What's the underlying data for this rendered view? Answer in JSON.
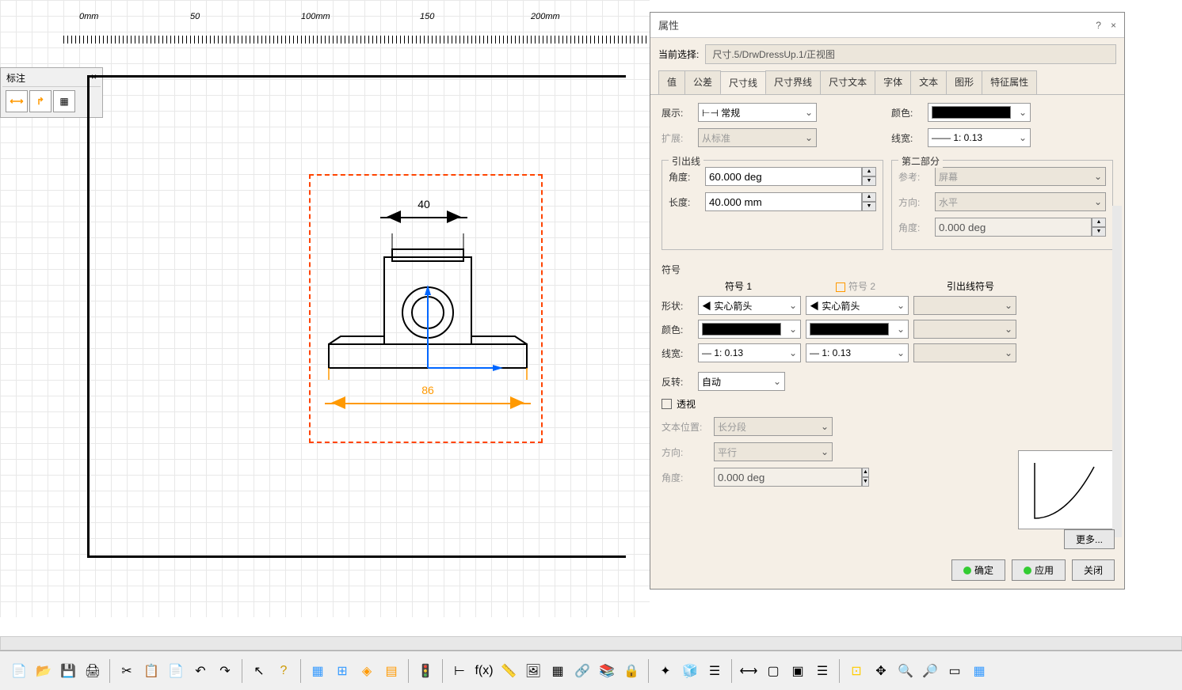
{
  "canvas": {
    "ruler_marks": [
      "0mm",
      "50",
      "100mm",
      "150",
      "200mm"
    ],
    "small_toolbar_title": "标注",
    "small_toolbar_close": "×",
    "dim_top": "40",
    "dim_bottom": "86"
  },
  "props": {
    "title": "属性",
    "help": "?",
    "close": "×",
    "current_sel_label": "当前选择:",
    "current_sel_value": "尺寸.5/DrwDressUp.1/正视图",
    "tabs": [
      "值",
      "公差",
      "尺寸线",
      "尺寸界线",
      "尺寸文本",
      "字体",
      "文本",
      "图形",
      "特征属性"
    ],
    "active_tab": "尺寸线",
    "display_label": "展示:",
    "display_value": "常规",
    "extend_label": "扩展:",
    "extend_value": "从标准",
    "color_label": "颜色:",
    "linewidth_label": "线宽:",
    "linewidth_value": "1: 0.13",
    "leader": {
      "title": "引出线",
      "angle_label": "角度:",
      "angle_value": "60.000 deg",
      "length_label": "长度:",
      "length_value": "40.000 mm"
    },
    "part2": {
      "title": "第二部分",
      "ref_label": "参考:",
      "ref_value": "屏幕",
      "dir_label": "方向:",
      "dir_value": "水平",
      "angle_label": "角度:",
      "angle_value": "0.000 deg"
    },
    "symbols": {
      "title": "符号",
      "sym1_header": "符号 1",
      "sym2_header": "符号 2",
      "leader_sym_header": "引出线符号",
      "shape_label": "形状:",
      "shape_value": "实心箭头",
      "color_label": "颜色:",
      "lw_label": "线宽:",
      "lw_value": "1: 0.13"
    },
    "reverse_label": "反转:",
    "reverse_value": "自动",
    "perspective_label": "透视",
    "text_pos_label": "文本位置:",
    "text_pos_value": "长分段",
    "dir_label": "方向:",
    "dir_value": "平行",
    "ang_label": "角度:",
    "ang_value": "0.000 deg",
    "more_btn": "更多...",
    "ok_btn": "确定",
    "apply_btn": "应用",
    "close_btn": "关闭"
  },
  "icons": {
    "display_icon": "⊢⊣"
  }
}
